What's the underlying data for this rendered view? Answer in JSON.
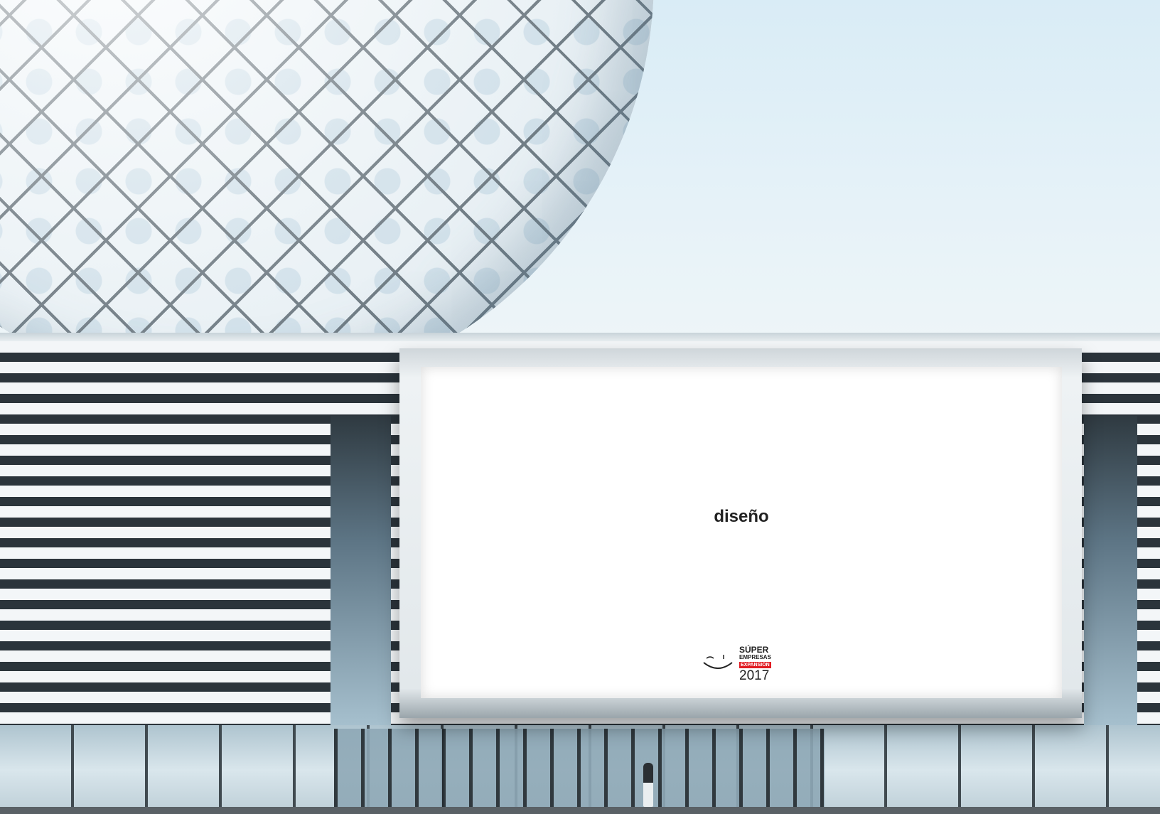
{
  "billboard": {
    "headline": "diseño",
    "logo": {
      "line1": "SÚPER",
      "line2": "EMPRESAS",
      "line3": "EXPANSIÓN",
      "year": "2017",
      "accent_color": "#e11b22"
    }
  },
  "colors": {
    "sky": "#dfeef6",
    "billboard": "#ffffff"
  }
}
